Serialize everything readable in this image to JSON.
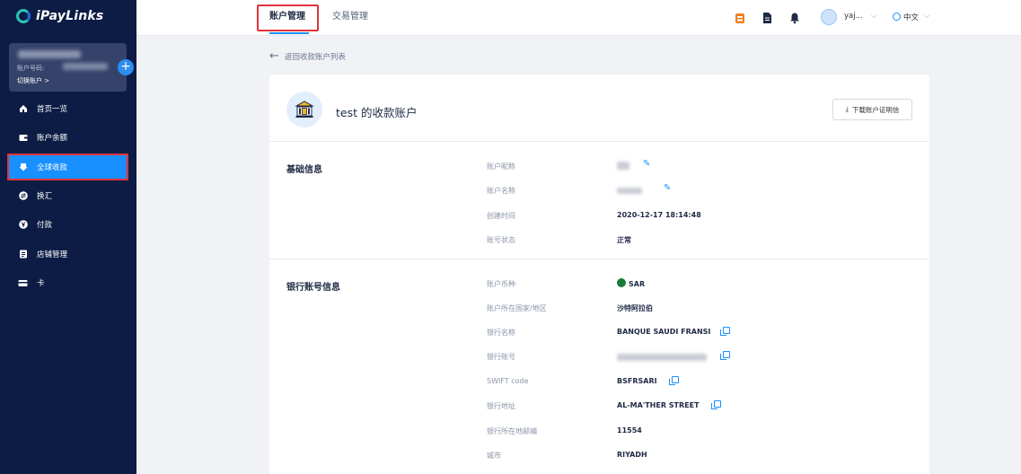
{
  "brand": {
    "name": "iPayLinks"
  },
  "account": {
    "number_label": "账户号码:",
    "switch_label": "切换账户 >",
    "add": "+"
  },
  "nav": [
    {
      "label": "首页一览",
      "icon": "home-icon"
    },
    {
      "label": "账户余额",
      "icon": "wallet-icon"
    },
    {
      "label": "全球收款",
      "icon": "receive-icon"
    },
    {
      "label": "换汇",
      "icon": "exchange-icon"
    },
    {
      "label": "付款",
      "icon": "yen-icon"
    },
    {
      "label": "店铺管理",
      "icon": "store-icon"
    },
    {
      "label": "卡",
      "icon": "card-icon"
    }
  ],
  "tabs": [
    {
      "label": "账户管理"
    },
    {
      "label": "交易管理"
    }
  ],
  "user": {
    "name": "yaj..."
  },
  "language": {
    "label": "中文"
  },
  "back": {
    "label": "返回收款账户列表"
  },
  "card": {
    "title": "test 的收款账户",
    "download_label": "下载账户证明信"
  },
  "basic": {
    "title": "基础信息",
    "fields": [
      {
        "label": "账户昵称",
        "value": ""
      },
      {
        "label": "账户名称",
        "value": ""
      },
      {
        "label": "创建时间",
        "value": "2020-12-17 18:14:48"
      },
      {
        "label": "账号状态",
        "value": "正常"
      }
    ]
  },
  "bank": {
    "title": "银行账号信息",
    "fields": [
      {
        "label": "账户币种",
        "value": "SAR"
      },
      {
        "label": "账户所在国家/地区",
        "value": "沙特阿拉伯"
      },
      {
        "label": "银行名称",
        "value": "BANQUE SAUDI FRANSI"
      },
      {
        "label": "银行账号",
        "value": ""
      },
      {
        "label": "SWIFT code",
        "value": "BSFRSARI"
      },
      {
        "label": "银行地址",
        "value": "AL-MA'THER STREET"
      },
      {
        "label": "银行所在地邮编",
        "value": "11554"
      },
      {
        "label": "城市",
        "value": "RIYADH"
      }
    ]
  },
  "colors": {
    "sidebar": "#0c1c44",
    "accent": "#1890ff",
    "highlight": "#e0343a"
  }
}
